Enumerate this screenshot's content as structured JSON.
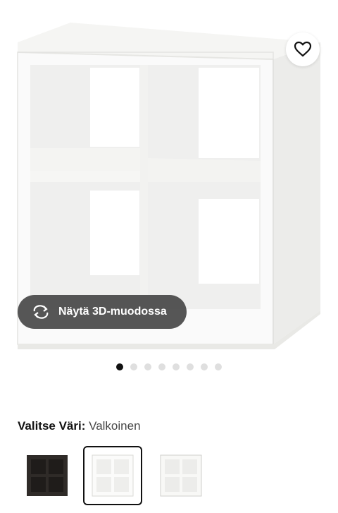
{
  "product": {
    "image_alt": "KALLAX hylly, valkoinen",
    "favorite_icon": "heart-outline-icon",
    "view_3d_label": "Näytä 3D-muodossa",
    "view_3d_icon": "rotate-arrows-icon"
  },
  "carousel": {
    "total_images": 8,
    "active_index": 0
  },
  "color_selector": {
    "label": "Valitse Väri:",
    "selected_value": "Valkoinen",
    "options": [
      {
        "color": "#2f2b28",
        "trim": "#1f1c1a"
      },
      {
        "color": "#f7f7f5",
        "trim": "#d9d9d6",
        "selected": true
      },
      {
        "color": "#f4f4f2",
        "trim": "#cfcfcc"
      }
    ]
  }
}
